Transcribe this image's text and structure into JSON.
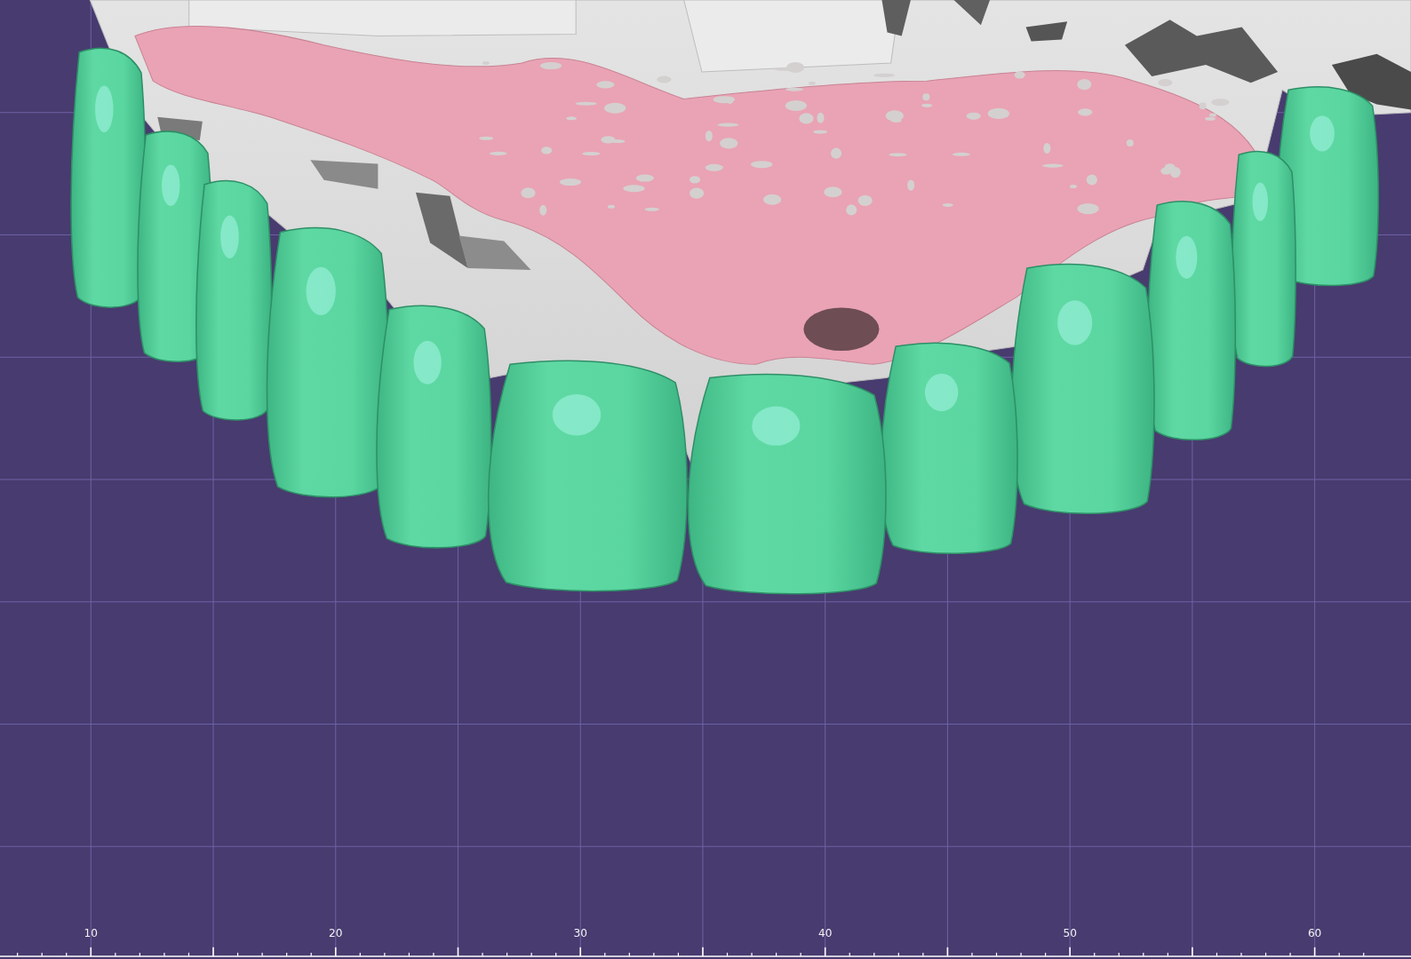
{
  "viewport": {
    "ruler": {
      "labels": [
        "10",
        "20",
        "30",
        "40",
        "50",
        "60"
      ]
    }
  }
}
